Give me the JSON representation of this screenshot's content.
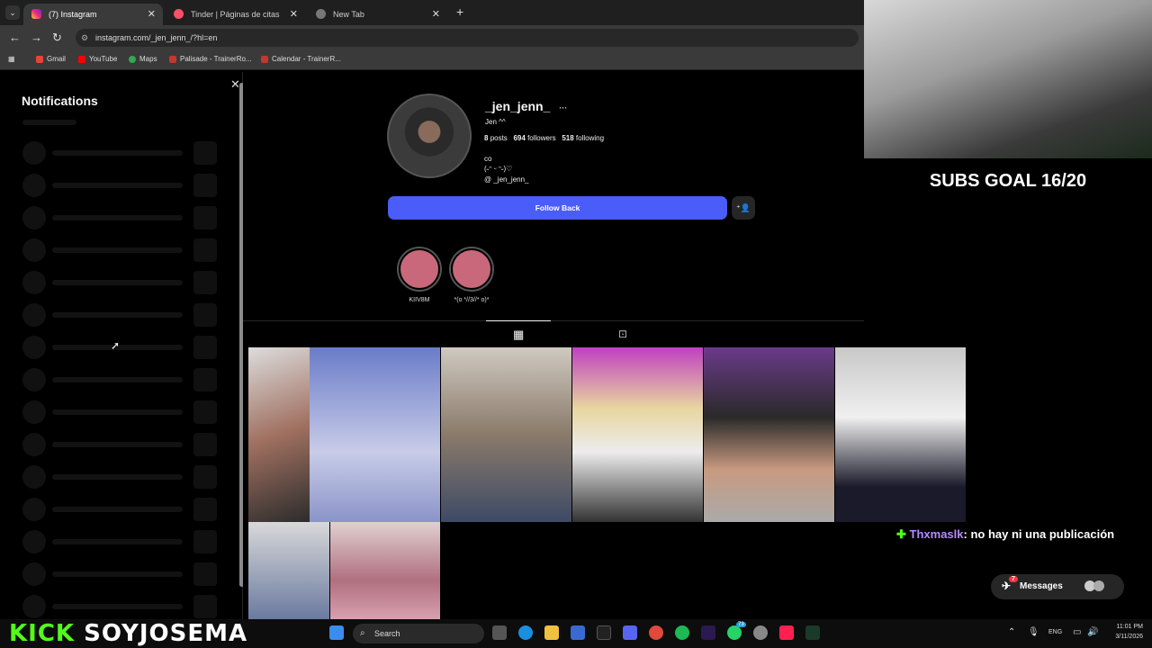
{
  "browser": {
    "tabs": [
      {
        "label": "(7) Instagram",
        "active": true
      },
      {
        "label": "Tinder | Páginas de citas",
        "active": false
      },
      {
        "label": "New Tab",
        "active": false
      }
    ],
    "url": "instagram.com/_jen_jenn_/?hl=en",
    "bookmarks": [
      "Gmail",
      "YouTube",
      "Maps",
      "Palisade - TrainerRo...",
      "Calendar - TrainerR..."
    ]
  },
  "notifications": {
    "title": "Notifications"
  },
  "profile": {
    "username": "_jen_jenn_",
    "more": "···",
    "display_name": "Jen ^^",
    "posts_count": "8",
    "posts_label": "posts",
    "followers_count": "694",
    "followers_label": "followers",
    "following_count": "518",
    "following_label": "following",
    "bio_line1": "co",
    "bio_line2": "(˶ᵔ ᵕ ᵔ˶)♡",
    "threads_handle": "_jen_jenn_",
    "follow_back_label": "Follow Back",
    "highlights": [
      {
        "label": "KIIV8M"
      },
      {
        "label": "*(o *//3//* o)*"
      }
    ]
  },
  "overlay": {
    "subs_goal": "SUBS GOAL 16/20",
    "chat_user": "Thxmaslk",
    "chat_message": ": no hay ni una publicación",
    "messages_label": "Messages",
    "messages_badge": "7",
    "kick_brand": "KICK",
    "kick_channel": "SOYJOSEMA"
  },
  "taskbar": {
    "search_placeholder": "Search",
    "lang": "ENG",
    "time": "11:01 PM",
    "date": "3/11/2026",
    "badge_count": "73"
  },
  "colors": {
    "follow_button": "#4a5df9",
    "highlight": "#c9687b",
    "kick_green": "#53fc18"
  }
}
